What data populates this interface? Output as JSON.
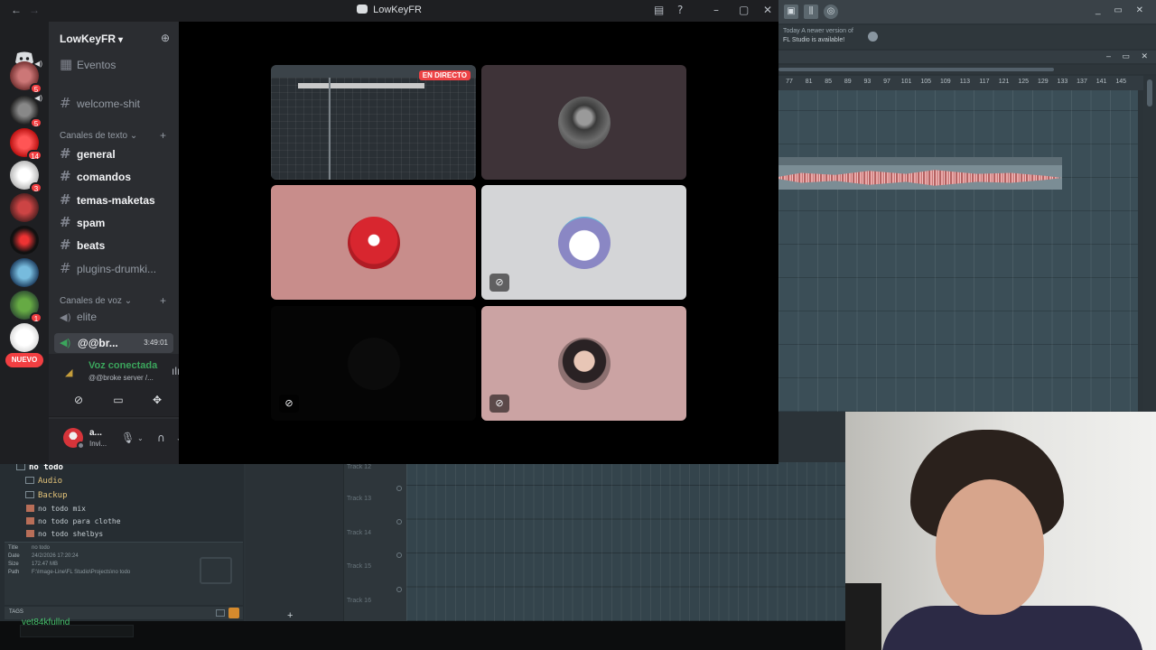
{
  "discord": {
    "window_title": "LowKeyFR",
    "server_name": "LowKeyFR",
    "events_label": "Eventos",
    "channels_top": [
      {
        "name": "welcome-shit",
        "unread": false
      }
    ],
    "text_category": "Canales de texto",
    "text_channels": [
      {
        "name": "general",
        "unread": true
      },
      {
        "name": "comandos",
        "unread": true
      },
      {
        "name": "temas-maketas",
        "unread": true
      },
      {
        "name": "spam",
        "unread": true
      },
      {
        "name": "beats",
        "unread": true
      },
      {
        "name": "plugins-drumki...",
        "unread": false
      }
    ],
    "voice_category": "Canales de voz",
    "voice_channels": [
      {
        "name": "elite"
      }
    ],
    "active_voice": {
      "name": "@@br...",
      "time": "3:49:01"
    },
    "servers": [
      {
        "badge": "5"
      },
      {
        "badge": "5"
      },
      {
        "badge": "14"
      },
      {
        "badge": "3"
      },
      {
        "badge": ""
      },
      {
        "badge": ""
      },
      {
        "badge": ""
      },
      {
        "badge": "1"
      }
    ],
    "new_label": "NUEVO",
    "voice_panel": {
      "status": "Voz conectada",
      "server": "@@broke server /..."
    },
    "user": {
      "name": "a...",
      "status": "Invi..."
    },
    "stage": {
      "live_badge": "EN DIRECTO"
    }
  },
  "fl": {
    "news_line1": "Today  A newer version of",
    "news_line2": "FL Studio is available!",
    "ruler_ticks": [
      "77",
      "81",
      "85",
      "89",
      "93",
      "97",
      "101",
      "105",
      "109",
      "113",
      "117",
      "121",
      "125",
      "129",
      "133",
      "137",
      "141",
      "145"
    ],
    "browser": {
      "root": "no todo",
      "folders": [
        "Audio",
        "Backup"
      ],
      "files": [
        "no todo mix",
        "no todo para clothe",
        "no todo shelbys"
      ]
    },
    "meta": [
      {
        "k": "Title",
        "v": "no todo"
      },
      {
        "k": "Date",
        "v": "24/2/2026 17:20:24"
      },
      {
        "k": "Size",
        "v": "172.47 MB"
      },
      {
        "k": "Path",
        "v": "F:\\Image-Line\\FL Studio\\Projects\\no todo"
      }
    ],
    "tags_label": "TAGS",
    "tracks": [
      "Track 12",
      "Track 13",
      "Track 14",
      "Track 15",
      "Track 16"
    ],
    "overlay_text": "vet84kfullnd"
  }
}
